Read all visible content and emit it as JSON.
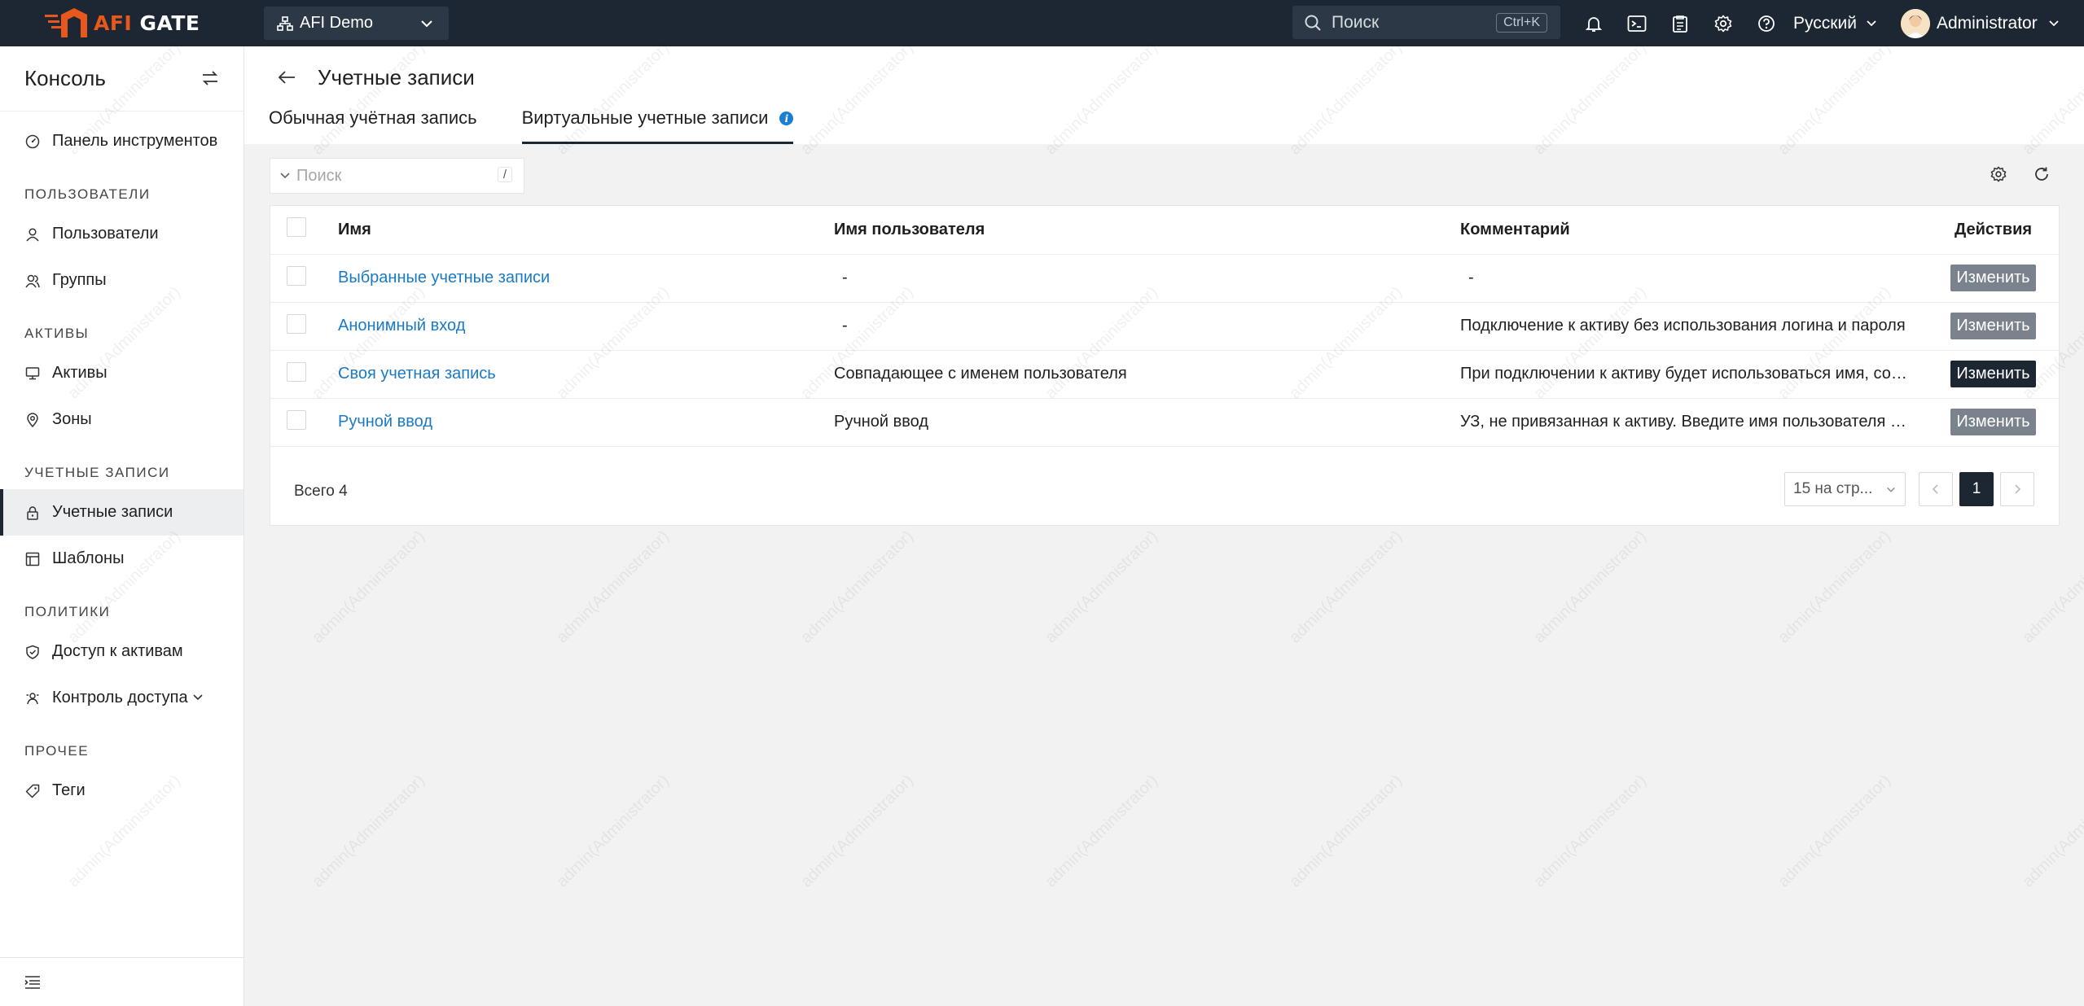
{
  "topbar": {
    "logo_afi": "AFI",
    "logo_gate": "GATE",
    "org": "AFI Demo",
    "search_placeholder": "Поиск",
    "search_shortcut": "Ctrl+K",
    "language": "Русский",
    "user_name": "Administrator",
    "icons": [
      "bell-icon",
      "terminal-icon",
      "clipboard-icon",
      "gear-icon",
      "help-icon"
    ]
  },
  "sidebar": {
    "title": "Консоль",
    "dashboard": "Панель инструментов",
    "sections": {
      "users": "ПОЛЬЗОВАТЕЛИ",
      "assets": "АКТИВЫ",
      "accounts": "УЧЕТНЫЕ ЗАПИСИ",
      "policies": "ПОЛИТИКИ",
      "other": "ПРОЧЕЕ"
    },
    "items": {
      "users": "Пользователи",
      "groups": "Группы",
      "assets": "Активы",
      "zones": "Зоны",
      "accounts": "Учетные записи",
      "templates": "Шаблоны",
      "asset_access": "Доступ к активам",
      "access_control": "Контроль доступа",
      "tags": "Теги"
    }
  },
  "page": {
    "title": "Учетные записи",
    "tabs": [
      "Обычная учётная запись",
      "Виртуальные учетные записи"
    ],
    "info_mark": "i"
  },
  "filter": {
    "placeholder": "Поиск",
    "shortcut": "/"
  },
  "table": {
    "columns": [
      "Имя",
      "Имя пользователя",
      "Комментарий",
      "Действия"
    ],
    "rows": [
      {
        "name": "Выбранные учетные записи",
        "username": "-",
        "comment": "-",
        "action": "Изменить"
      },
      {
        "name": "Анонимный вход",
        "username": "-",
        "comment": "Подключение к активу без использования логина и пароля",
        "action": "Изменить"
      },
      {
        "name": "Своя учетная запись",
        "username": "Совпадающее с именем пользователя",
        "comment": "При подключении к активу будет использоваться имя, совпадающее с именем пользователя",
        "action": "Изменить"
      },
      {
        "name": "Ручной ввод",
        "username": "Ручной ввод",
        "comment": "УЗ, не привязанная к активу. Введите имя пользователя и пароль при подключении",
        "action": "Изменить"
      }
    ]
  },
  "pagination": {
    "total": "Всего 4",
    "page_size": "15 на стр...",
    "current_page": "1"
  },
  "watermark_text": "admin(Administrator)",
  "colors": {
    "topbar": "#1d2733",
    "brand_orange": "#e8581c",
    "link": "#1a7ac6",
    "button_gray": "#7a838d",
    "button_dark": "#1d2733"
  }
}
